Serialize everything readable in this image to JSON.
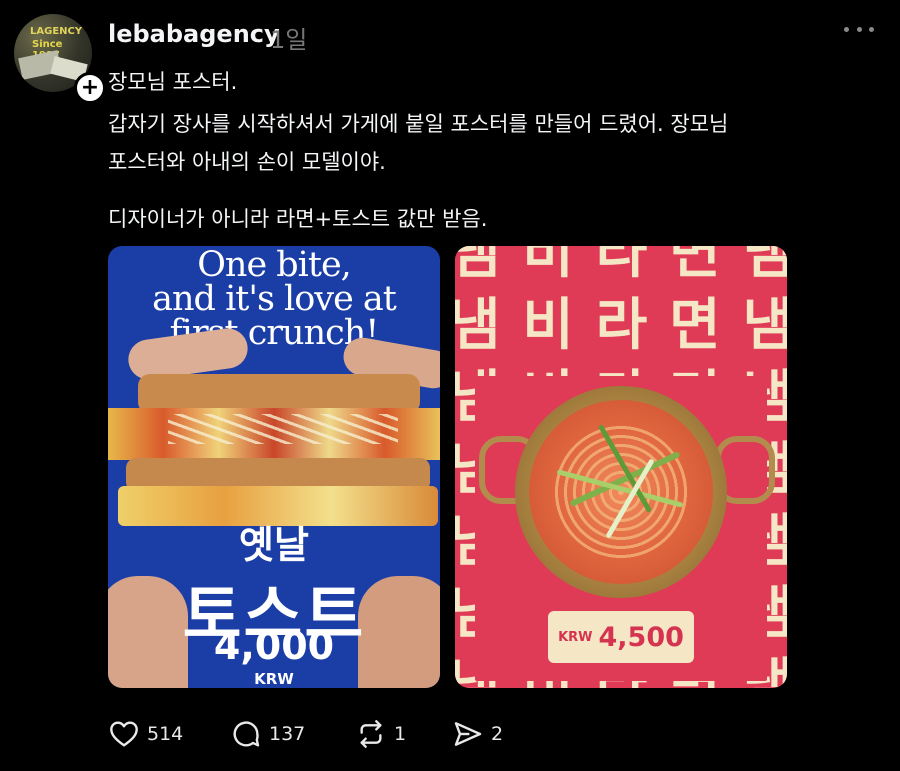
{
  "post": {
    "username": "lebabagency",
    "time": "1일",
    "avatar_text": [
      "LAGENCY",
      "Since 1987"
    ],
    "body_lines": [
      "장모님 포스터.",
      "갑자기 장사를 시작하셔서 가게에 붙일 포스터를 만들어 드렸어. 장모님",
      "포스터와 아내의 손이 모델이야.",
      "디자이너가 아니라 라면+토스트 값만 받음."
    ]
  },
  "images": {
    "toast": {
      "headline": [
        "One bite,",
        "and it's love at",
        "first crunch!"
      ],
      "label_small": "옛날",
      "label_big": "토스트",
      "price": "4,000",
      "currency": "KRW",
      "bg_color": "#1a3da6"
    },
    "ramen": {
      "tile_text": [
        "냄",
        "비",
        "라",
        "면"
      ],
      "price_currency": "KRW",
      "price": "4,500",
      "bg_color": "#e03b56",
      "accent_color": "#f5e6c6"
    }
  },
  "actions": {
    "likes": "514",
    "comments": "137",
    "reposts": "1",
    "shares": "2"
  }
}
